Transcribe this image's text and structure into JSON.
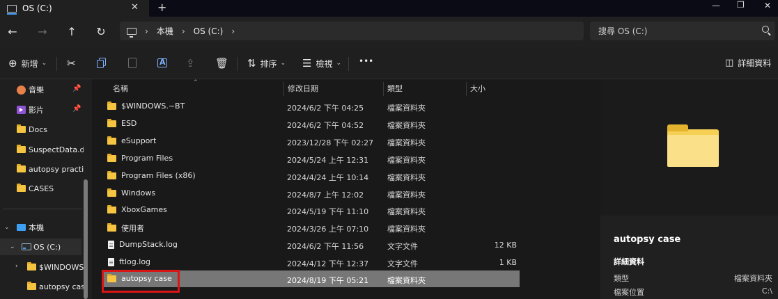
{
  "window": {
    "tab_title": "OS (C:)",
    "tab_close": "✕",
    "new_tab": "+",
    "controls": {
      "minimize": "—",
      "maximize": "❐",
      "close": "✕"
    }
  },
  "nav": {
    "back": "←",
    "forward": "→",
    "up": "↑",
    "refresh": "↻",
    "breadcrumb": [
      "本機",
      "OS (C:)"
    ],
    "search_placeholder": "搜尋 OS (C:)"
  },
  "toolbar": {
    "new_label": "新增",
    "sort_label": "排序",
    "view_label": "檢視",
    "more": "•••",
    "details_label": "詳細資料"
  },
  "sidebar": {
    "pinned": [
      {
        "label": "音樂",
        "icon": "music-icon"
      },
      {
        "label": "影片",
        "icon": "video-icon"
      },
      {
        "label": "Docs",
        "icon": "folder-icon"
      },
      {
        "label": "SuspectData.dc",
        "icon": "folder-icon"
      },
      {
        "label": "autopsy practic",
        "icon": "folder-icon"
      },
      {
        "label": "CASES",
        "icon": "folder-icon"
      }
    ],
    "this_pc": "本機",
    "drive": "OS (C:)",
    "children": [
      {
        "label": "$WINDOWS"
      },
      {
        "label": "autopsy case"
      }
    ]
  },
  "columns": {
    "name": "名稱",
    "modified": "修改日期",
    "type": "類型",
    "size": "大小"
  },
  "files": [
    {
      "name": "$WINDOWS.~BT",
      "modified": "2024/6/2 下午 04:25",
      "type": "檔案資料夾",
      "size": "",
      "kind": "folder"
    },
    {
      "name": "ESD",
      "modified": "2024/6/2 下午 04:52",
      "type": "檔案資料夾",
      "size": "",
      "kind": "folder"
    },
    {
      "name": "eSupport",
      "modified": "2023/12/28 下午 02:27",
      "type": "檔案資料夾",
      "size": "",
      "kind": "folder"
    },
    {
      "name": "Program Files",
      "modified": "2024/5/24 上午 12:31",
      "type": "檔案資料夾",
      "size": "",
      "kind": "folder"
    },
    {
      "name": "Program Files (x86)",
      "modified": "2024/4/24 上午 10:14",
      "type": "檔案資料夾",
      "size": "",
      "kind": "folder"
    },
    {
      "name": "Windows",
      "modified": "2024/8/7 上午 12:02",
      "type": "檔案資料夾",
      "size": "",
      "kind": "folder"
    },
    {
      "name": "XboxGames",
      "modified": "2024/5/19 下午 11:10",
      "type": "檔案資料夾",
      "size": "",
      "kind": "folder"
    },
    {
      "name": "使用者",
      "modified": "2024/3/26 上午 07:10",
      "type": "檔案資料夾",
      "size": "",
      "kind": "folder"
    },
    {
      "name": "DumpStack.log",
      "modified": "2024/6/2 下午 11:56",
      "type": "文字文件",
      "size": "12 KB",
      "kind": "doc"
    },
    {
      "name": "ftlog.log",
      "modified": "2024/4/12 下午 12:37",
      "type": "文字文件",
      "size": "1 KB",
      "kind": "doc"
    },
    {
      "name": "autopsy case",
      "modified": "2024/8/19 下午 05:21",
      "type": "檔案資料夾",
      "size": "",
      "kind": "folder",
      "selected": true
    }
  ],
  "details": {
    "title": "autopsy case",
    "section": "詳細資料",
    "props": [
      {
        "label": "類型",
        "value": "檔案資料夾"
      },
      {
        "label": "檔案位置",
        "value": "C:\\"
      }
    ]
  },
  "colors": {
    "accent": "#3ea0f5",
    "folder": "#f5c542",
    "highlight": "#d91515",
    "selected_row": "#777777"
  }
}
